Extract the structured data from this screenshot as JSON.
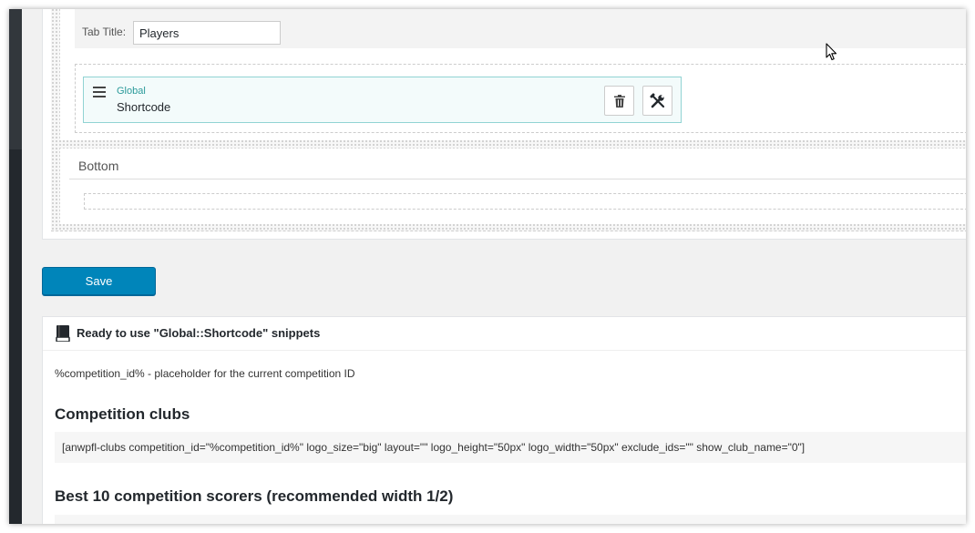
{
  "tab_editor": {
    "tab_title_label": "Tab Title:",
    "tab_title_value": "Players"
  },
  "widget": {
    "category": "Global",
    "name": "Shortcode",
    "delete_icon": "trash-icon",
    "settings_icon": "tools-icon"
  },
  "bottom_section": {
    "label": "Bottom"
  },
  "actions": {
    "save_label": "Save"
  },
  "snippets": {
    "icon": "book-icon",
    "title": "Ready to use \"Global::Shortcode\" snippets",
    "placeholder_token": "%competition_id%",
    "placeholder_desc": " - placeholder for the current competition ID",
    "sections": [
      {
        "heading": "Competition clubs",
        "code": "[anwpfl-clubs competition_id=\"%competition_id%\" logo_size=\"big\" layout=\"\" logo_height=\"50px\" logo_width=\"50px\" exclude_ids=\"\" show_club_name=\"0\"]"
      },
      {
        "heading": "Best 10 competition scorers (recommended width 1/2)"
      }
    ]
  },
  "colors": {
    "accent": "#0085ba",
    "widget_border": "#91d3d3",
    "widget_category": "#2b9a9a",
    "admin_bar": "#23282d"
  }
}
